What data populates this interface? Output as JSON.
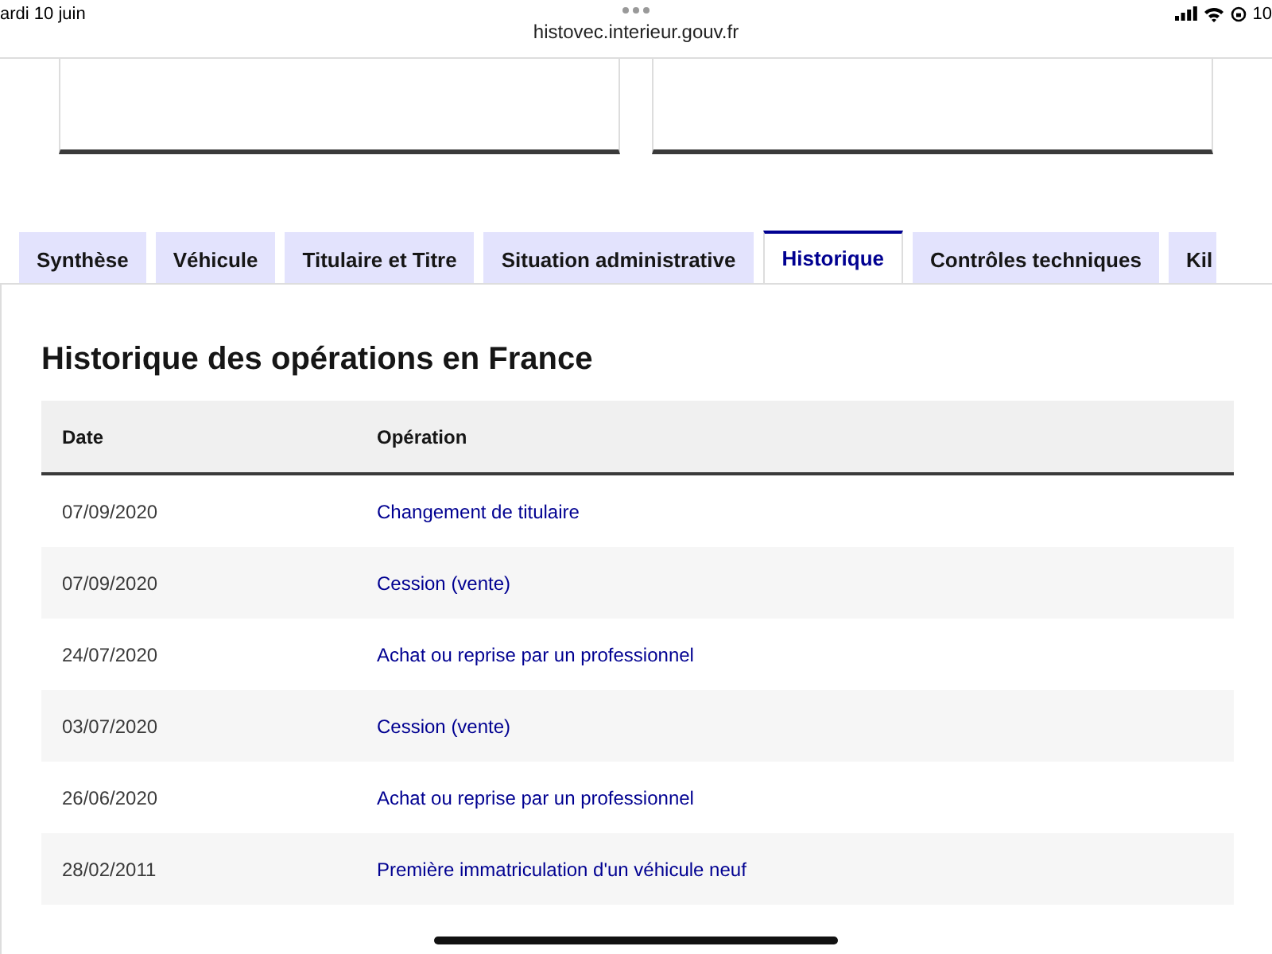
{
  "status_bar": {
    "date": "ardi 10 juin",
    "url": "histovec.interieur.gouv.fr",
    "battery": "10"
  },
  "tabs": [
    {
      "label": "Synthèse",
      "selected": false
    },
    {
      "label": "Véhicule",
      "selected": false
    },
    {
      "label": "Titulaire et Titre",
      "selected": false
    },
    {
      "label": "Situation administrative",
      "selected": false
    },
    {
      "label": "Historique",
      "selected": true
    },
    {
      "label": "Contrôles techniques",
      "selected": false
    },
    {
      "label": "Kil",
      "selected": false
    }
  ],
  "section": {
    "title": "Historique des opérations en France"
  },
  "table": {
    "columns": [
      "Date",
      "Opération"
    ],
    "rows": [
      [
        "07/09/2020",
        "Changement de titulaire"
      ],
      [
        "07/09/2020",
        "Cession (vente)"
      ],
      [
        "24/07/2020",
        "Achat ou reprise par un professionnel"
      ],
      [
        "03/07/2020",
        "Cession (vente)"
      ],
      [
        "26/06/2020",
        "Achat ou reprise par un professionnel"
      ],
      [
        "28/02/2011",
        "Première immatriculation d'un véhicule neuf"
      ]
    ]
  }
}
